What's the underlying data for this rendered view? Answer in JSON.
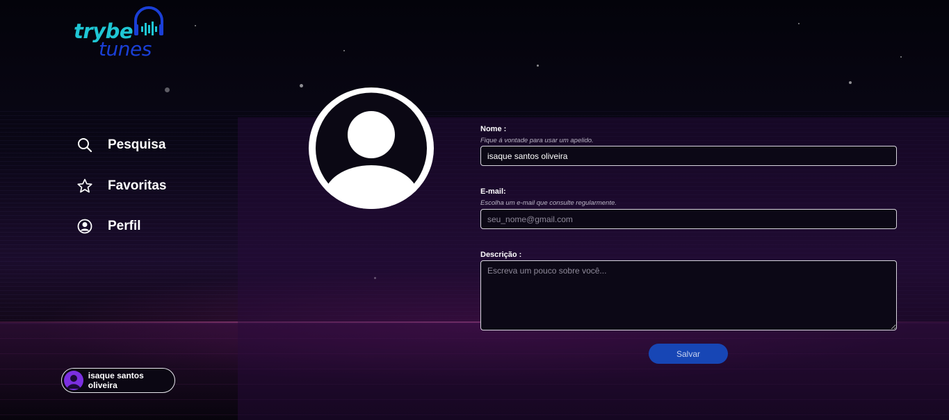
{
  "logo": {
    "line1": "trybe",
    "line2": "tunes",
    "icon": "headphones-equalizer-icon"
  },
  "nav": {
    "items": [
      {
        "label": "Pesquisa",
        "icon": "search-icon"
      },
      {
        "label": "Favoritas",
        "icon": "star-icon"
      },
      {
        "label": "Perfil",
        "icon": "user-circle-icon"
      }
    ]
  },
  "user": {
    "name": "isaque santos oliveira",
    "avatar_color": "#7b2fe0"
  },
  "profile": {
    "avatar_icon": "default-user-avatar-icon",
    "name_label": "Nome :",
    "name_hint": "Fique á vontade para usar um apelido.",
    "name_value": "isaque santos oliveira",
    "email_label": "E-mail:",
    "email_hint": "Escolha um e-mail que consulte regularmente.",
    "email_placeholder": "seu_nome@gmail.com",
    "description_label": "Descrição :",
    "description_placeholder": "Escreva um pouco sobre você...",
    "save_label": "Salvar"
  },
  "colors": {
    "accent": "#1746b5",
    "logo_cyan": "#1fc6d4",
    "logo_blue": "#1a3fd6"
  }
}
